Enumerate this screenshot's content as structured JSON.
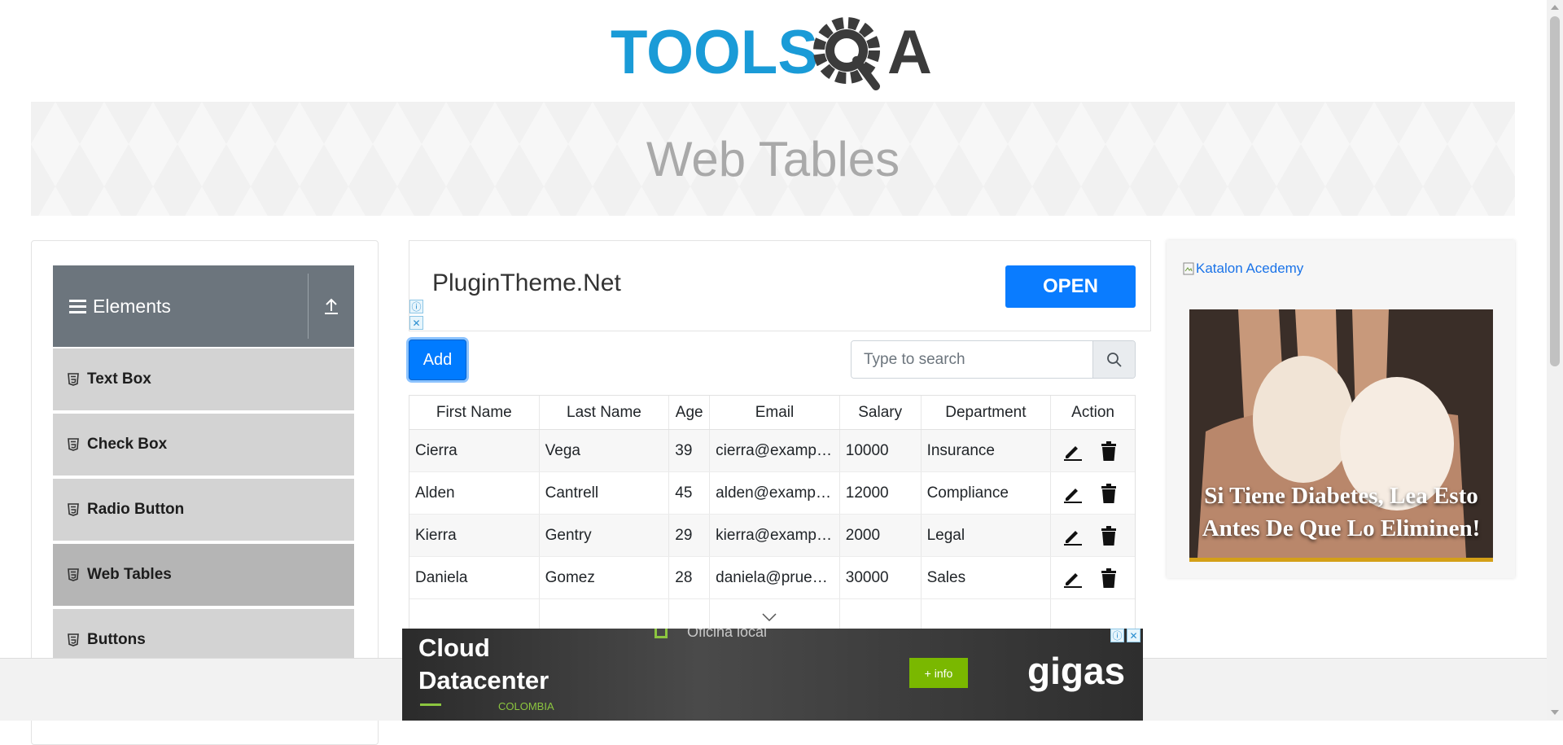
{
  "header": {
    "logo_text_left": "TOOLS",
    "logo_text_right": "QA",
    "banner_title": "Web Tables"
  },
  "sidebar": {
    "group_title": "Elements",
    "items": [
      {
        "label": "Text Box",
        "active": false
      },
      {
        "label": "Check Box",
        "active": false
      },
      {
        "label": "Radio Button",
        "active": false
      },
      {
        "label": "Web Tables",
        "active": true
      },
      {
        "label": "Buttons",
        "active": false
      }
    ]
  },
  "ad_top": {
    "title": "PluginTheme.Net",
    "button": "OPEN",
    "info_glyph": "ⓘ",
    "close_glyph": "✕"
  },
  "toolbar": {
    "add_label": "Add",
    "search_placeholder": "Type to search"
  },
  "table": {
    "headers": [
      "First Name",
      "Last Name",
      "Age",
      "Email",
      "Salary",
      "Department",
      "Action"
    ],
    "rows": [
      {
        "first": "Cierra",
        "last": "Vega",
        "age": "39",
        "email": "cierra@example.com",
        "salary": "10000",
        "department": "Insurance"
      },
      {
        "first": "Alden",
        "last": "Cantrell",
        "age": "45",
        "email": "alden@example.com",
        "salary": "12000",
        "department": "Compliance"
      },
      {
        "first": "Kierra",
        "last": "Gentry",
        "age": "29",
        "email": "kierra@example.com",
        "salary": "2000",
        "department": "Legal"
      },
      {
        "first": "Daniela",
        "last": "Gomez",
        "age": "28",
        "email": "daniela@pruebas.com",
        "salary": "30000",
        "department": "Sales"
      }
    ]
  },
  "ad_right": {
    "image_alt": "Katalon Acedemy",
    "caption": "Si Tiene Diabetes, Lea Esto Antes De Que Lo Eliminen!"
  },
  "ad_bottom": {
    "partial_text": "Oficina local",
    "line1": "Cloud",
    "line2": "Datacenter",
    "country": "COLOMBIA",
    "button": "+ info",
    "brand": "gigas"
  },
  "colors": {
    "primary": "#007bff",
    "logo_blue": "#1a9bd7",
    "logo_dark": "#3b3b3b",
    "sidebar_header": "#6c757d",
    "menu_item": "#d3d3d3",
    "menu_active": "#b5b5b5"
  }
}
